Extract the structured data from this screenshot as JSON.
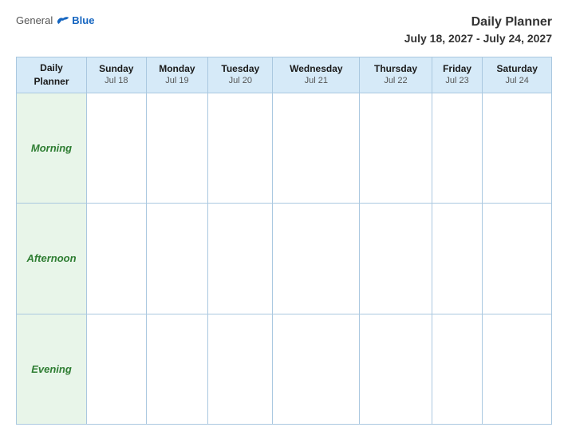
{
  "header": {
    "logo": {
      "general": "General",
      "blue": "Blue",
      "bird_alt": "blue bird"
    },
    "title_line1": "Daily Planner",
    "title_line2": "July 18, 2027 - July 24, 2027"
  },
  "calendar": {
    "corner_label_line1": "Daily",
    "corner_label_line2": "Planner",
    "columns": [
      {
        "day": "Sunday",
        "date": "Jul 18"
      },
      {
        "day": "Monday",
        "date": "Jul 19"
      },
      {
        "day": "Tuesday",
        "date": "Jul 20"
      },
      {
        "day": "Wednesday",
        "date": "Jul 21"
      },
      {
        "day": "Thursday",
        "date": "Jul 22"
      },
      {
        "day": "Friday",
        "date": "Jul 23"
      },
      {
        "day": "Saturday",
        "date": "Jul 24"
      }
    ],
    "rows": [
      {
        "label": "Morning"
      },
      {
        "label": "Afternoon"
      },
      {
        "label": "Evening"
      }
    ]
  }
}
